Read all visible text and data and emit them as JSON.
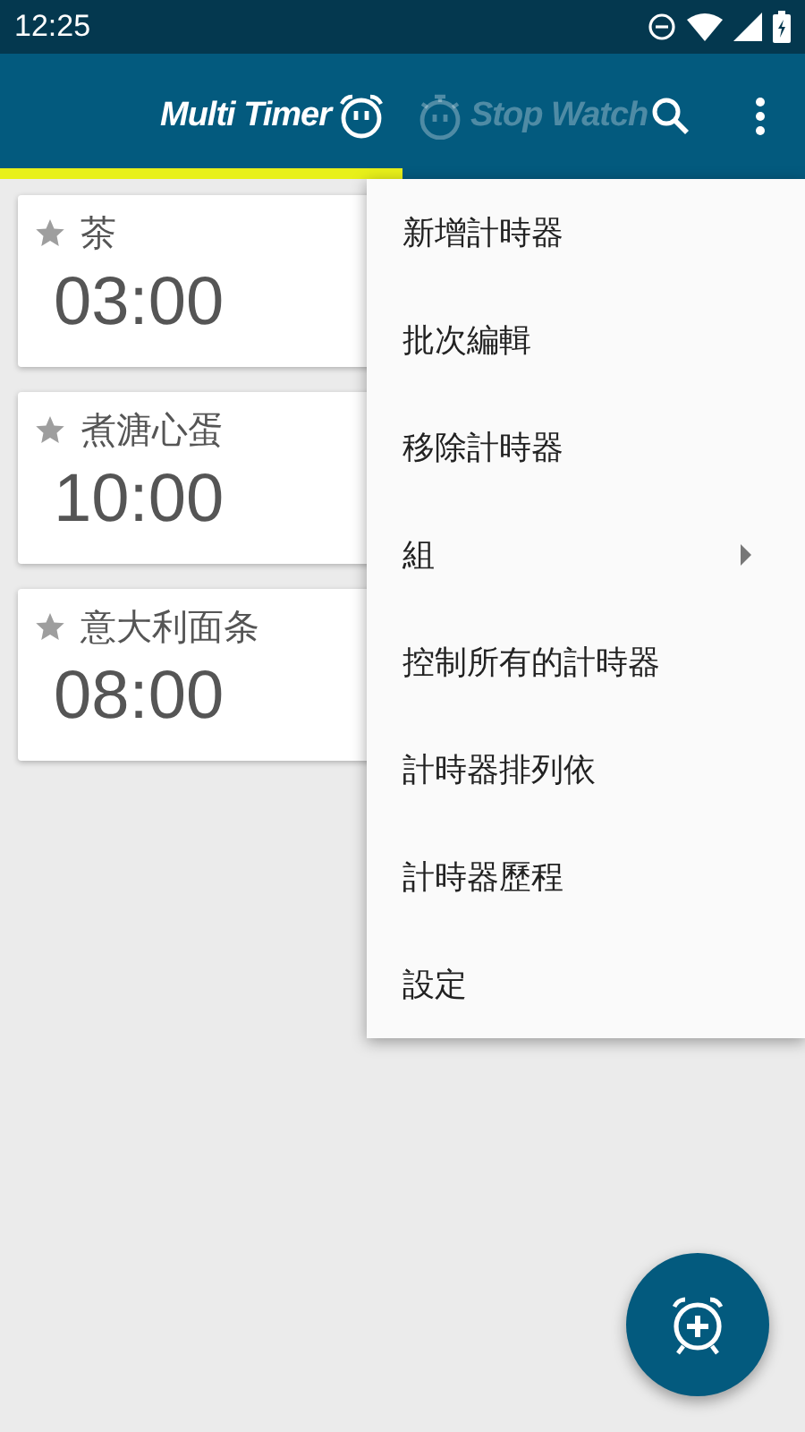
{
  "status_bar": {
    "time": "12:25"
  },
  "tabs": [
    {
      "label": "Multi Timer",
      "selected": true
    },
    {
      "label": "Stop Watch",
      "selected": false
    }
  ],
  "timers": [
    {
      "name": "茶",
      "time": "03:00"
    },
    {
      "name": "煮溏心蛋",
      "time": "10:00"
    },
    {
      "name": "意大利面条",
      "time": "08:00"
    }
  ],
  "menu": [
    {
      "label": "新增計時器",
      "has_submenu": false
    },
    {
      "label": "批次編輯",
      "has_submenu": false
    },
    {
      "label": "移除計時器",
      "has_submenu": false
    },
    {
      "label": "組",
      "has_submenu": true
    },
    {
      "label": "控制所有的計時器",
      "has_submenu": false
    },
    {
      "label": "計時器排列依",
      "has_submenu": false
    },
    {
      "label": "計時器歷程",
      "has_submenu": false
    },
    {
      "label": "設定",
      "has_submenu": false
    }
  ]
}
